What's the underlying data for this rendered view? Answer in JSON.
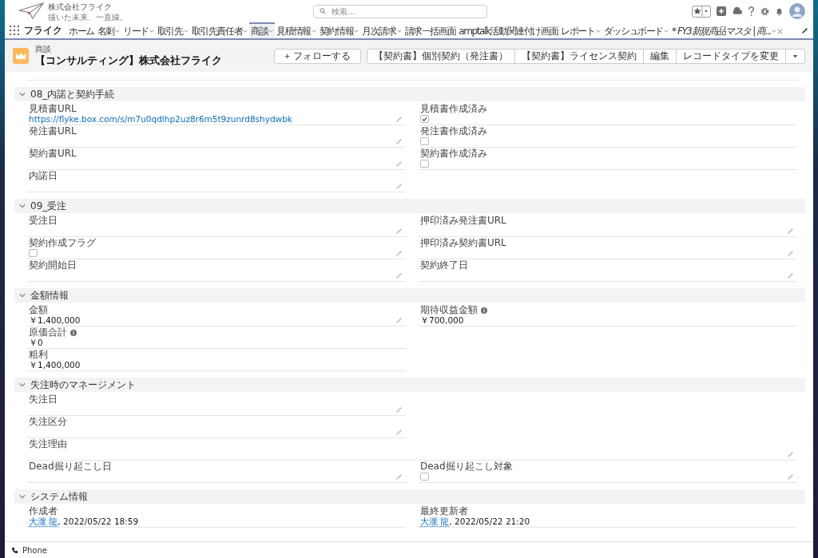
{
  "header": {
    "company": "株式会社フライク",
    "tagline": "描いた未来、一直線。",
    "search": {
      "placeholder": "検索..."
    }
  },
  "nav": {
    "app_name": "フライク",
    "items": [
      {
        "label": "ホーム",
        "kind": "item",
        "menu": false,
        "selected": false
      },
      {
        "label": "名刺",
        "kind": "item",
        "menu": true,
        "selected": false
      },
      {
        "label": "リード",
        "kind": "item",
        "menu": true,
        "selected": false
      },
      {
        "label": "取引先",
        "kind": "item",
        "menu": true,
        "selected": false
      },
      {
        "label": "取引先責任者",
        "kind": "item",
        "menu": true,
        "selected": false
      },
      {
        "label": "商談",
        "kind": "item",
        "menu": true,
        "selected": true
      },
      {
        "label": "見積情報",
        "kind": "item",
        "menu": true,
        "selected": false
      },
      {
        "label": "契約情報",
        "kind": "item",
        "menu": true,
        "selected": false
      },
      {
        "label": "月次請求",
        "kind": "item",
        "menu": true,
        "selected": false
      },
      {
        "label": "請求一括画面",
        "kind": "item",
        "menu": false,
        "selected": false
      },
      {
        "label": "amptalk活動関連付け画面",
        "kind": "item",
        "menu": false,
        "selected": false
      },
      {
        "label": "レポート",
        "kind": "item",
        "menu": true,
        "selected": false
      },
      {
        "label": "ダッシュボード",
        "kind": "item",
        "menu": true,
        "selected": false
      },
      {
        "label": "* FY3新規商品マスタ | 商...",
        "kind": "workspace",
        "menu": true,
        "selected": false
      }
    ]
  },
  "record": {
    "object": "商談",
    "title": "【コンサルティング】株式会社フライク",
    "buttons": [
      {
        "kind": "follow",
        "label": "フォローする"
      },
      {
        "kind": "group",
        "label": "【契約書】個別契約（発注書）"
      },
      {
        "kind": "group",
        "label": "【契約書】ライセンス契約"
      },
      {
        "kind": "group",
        "label": "編集"
      },
      {
        "kind": "group",
        "label": "レコードタイプを変更"
      },
      {
        "kind": "menu"
      }
    ]
  },
  "sections": [
    {
      "title": "08_内諾と契約手続",
      "expanded": true,
      "rows": [
        {
          "cells": [
            {
              "kind": "link",
              "label": "見積書URL",
              "value": "https://flyke.box.com/s/m7u0qdlhp2uz8r6m5t9zunrd8shydwbk",
              "editable": true
            },
            {
              "kind": "checkbox",
              "label": "見積書作成済み",
              "checked": true,
              "editable": false
            }
          ]
        },
        {
          "cells": [
            {
              "kind": "text",
              "label": "発注書URL",
              "editable": true
            },
            {
              "kind": "checkbox",
              "label": "発注書作成済み",
              "checked": false,
              "editable": false
            }
          ]
        },
        {
          "cells": [
            {
              "kind": "text",
              "label": "契約書URL",
              "editable": true
            },
            {
              "kind": "checkbox",
              "label": "契約書作成済み",
              "checked": false,
              "editable": false
            }
          ]
        },
        {
          "cells": [
            {
              "kind": "text",
              "label": "内諾日",
              "editable": true
            },
            {
              "kind": "blank"
            }
          ]
        }
      ]
    },
    {
      "title": "09_受注",
      "expanded": true,
      "rows": [
        {
          "cells": [
            {
              "kind": "text",
              "label": "受注日",
              "editable": true
            },
            {
              "kind": "text",
              "label": "押印済み発注書URL",
              "editable": true
            }
          ]
        },
        {
          "cells": [
            {
              "kind": "checkbox",
              "label": "契約作成フラグ",
              "checked": false,
              "editable": true
            },
            {
              "kind": "text",
              "label": "押印済み契約書URL",
              "editable": true
            }
          ]
        },
        {
          "cells": [
            {
              "kind": "text",
              "label": "契約開始日",
              "editable": true
            },
            {
              "kind": "text",
              "label": "契約終了日",
              "editable": true
            }
          ]
        }
      ]
    },
    {
      "title": "金額情報",
      "expanded": true,
      "rows": [
        {
          "cells": [
            {
              "kind": "text",
              "label": "金額",
              "value": "￥1,400,000",
              "editable": true
            },
            {
              "kind": "text",
              "label": "期待収益金額",
              "info": true,
              "value": "￥700,000",
              "editable": false
            }
          ]
        },
        {
          "cells": [
            {
              "kind": "text",
              "label": "原価合計",
              "info": true,
              "value": "￥0",
              "editable": false
            },
            {
              "kind": "blank"
            }
          ]
        },
        {
          "cells": [
            {
              "kind": "text",
              "label": "粗利",
              "value": "￥1,400,000",
              "editable": false
            },
            {
              "kind": "blank"
            }
          ]
        }
      ]
    },
    {
      "title": "失注時のマネージメント",
      "expanded": true,
      "rows": [
        {
          "cells": [
            {
              "kind": "text",
              "label": "失注日",
              "editable": true
            },
            {
              "kind": "blank"
            }
          ]
        },
        {
          "cells": [
            {
              "kind": "text",
              "label": "失注区分",
              "editable": true
            },
            {
              "kind": "blank"
            }
          ]
        },
        {
          "cells": [
            {
              "kind": "text",
              "label": "失注理由",
              "editable": true
            }
          ]
        },
        {
          "cells": [
            {
              "kind": "text",
              "label": "Dead掘り起こし日",
              "editable": true
            },
            {
              "kind": "checkbox",
              "label": "Dead掘り起こし対象",
              "checked": false,
              "editable": true
            }
          ]
        }
      ]
    },
    {
      "title": "システム情報",
      "expanded": true,
      "rows": [
        {
          "cells": [
            {
              "kind": "user_date",
              "label": "作成者",
              "user": "大瀧 龍",
              "date": ", 2022/05/22 18:59",
              "editable": false
            },
            {
              "kind": "user_date",
              "label": "最終更新者",
              "user": "大瀧 龍",
              "date": ", 2022/05/22 21:20",
              "editable": false
            }
          ]
        }
      ]
    }
  ],
  "utility_bar": {
    "items": [
      {
        "label": "Phone"
      }
    ]
  }
}
